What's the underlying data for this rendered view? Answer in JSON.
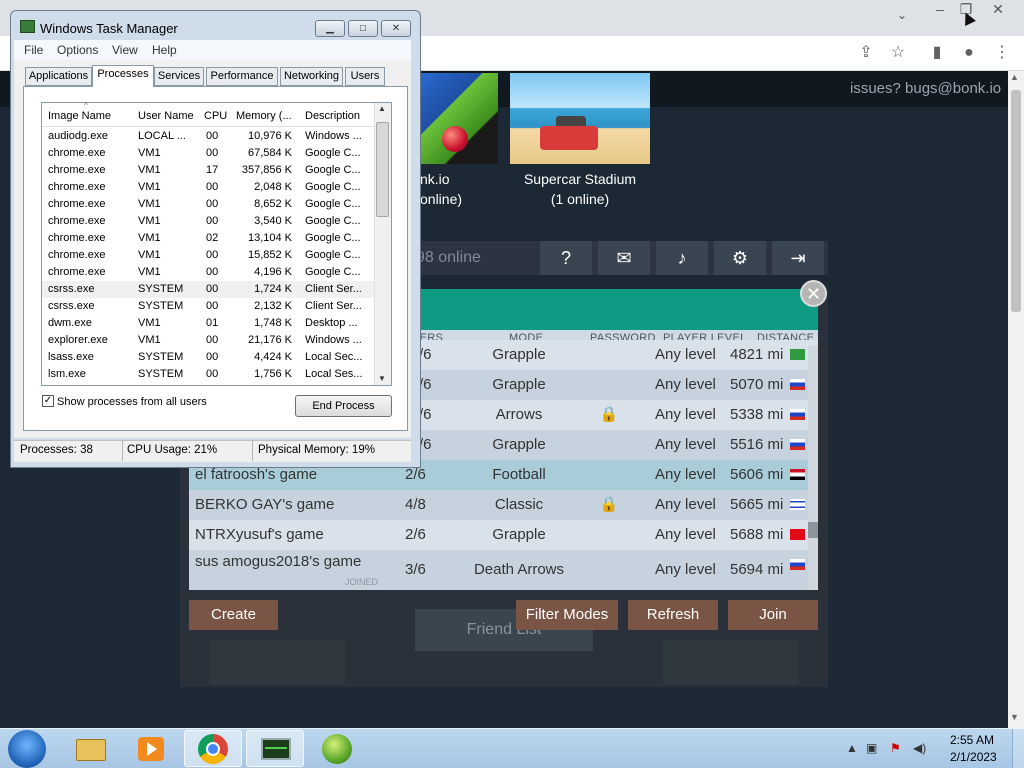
{
  "chrome": {
    "window_controls": [
      "–",
      "❐",
      "✕"
    ],
    "toolbar_icons": [
      "share-icon",
      "star-icon",
      "sidebar-icon",
      "profile-icon",
      "kebab-menu-icon"
    ]
  },
  "game": {
    "issues_text": "issues? bugs@bonk.io",
    "maps": [
      {
        "name": "nk.io",
        "online": "online)"
      },
      {
        "name": "Supercar Stadium",
        "online": "(1 online)"
      }
    ],
    "online_count": "98 online",
    "toolbar_icons": [
      "help-icon",
      "chat-icon",
      "speaker-icon",
      "settings-icon",
      "exit-icon"
    ],
    "close_label": "✕",
    "columns": [
      "YERS",
      "MODE",
      "PASSWORD",
      "PLAYER LEVEL",
      "DISTANCE"
    ],
    "rooms": [
      {
        "name": "",
        "players": "/6",
        "mode": "Grapple",
        "locked": false,
        "level": "Any level",
        "distance": "4821 mi",
        "flag": "Brazil"
      },
      {
        "name": "",
        "players": "/6",
        "mode": "Grapple",
        "locked": false,
        "level": "Any level",
        "distance": "5070 mi",
        "flag": "Russia"
      },
      {
        "name": "",
        "players": "/6",
        "mode": "Arrows",
        "locked": true,
        "level": "Any level",
        "distance": "5338 mi",
        "flag": "Russia"
      },
      {
        "name": "",
        "players": "/6",
        "mode": "Grapple",
        "locked": false,
        "level": "Any level",
        "distance": "5516 mi",
        "flag": "Russia"
      },
      {
        "name": "el fatroosh's game",
        "players": "2/6",
        "mode": "Football",
        "locked": false,
        "level": "Any level",
        "distance": "5606 mi",
        "flag": "Egypt"
      },
      {
        "name": "BERKO GAY's game",
        "players": "4/8",
        "mode": "Classic",
        "locked": true,
        "level": "Any level",
        "distance": "5665 mi",
        "flag": "Israel"
      },
      {
        "name": "NTRXyusuf's game",
        "players": "2/6",
        "mode": "Grapple",
        "locked": false,
        "level": "Any level",
        "distance": "5688 mi",
        "flag": "Turkey"
      },
      {
        "name": "sus amogus2018's game",
        "players": "3/6",
        "mode": "Death Arrows",
        "locked": false,
        "level": "Any level",
        "distance": "5694 mi",
        "flag": "Russia"
      }
    ],
    "joined_label": "JOINED",
    "buttons": {
      "create": "Create",
      "filter_modes": "Filter Modes",
      "refresh": "Refresh",
      "join": "Join"
    },
    "friend_list": "Friend List",
    "colors": {
      "header_teal": "#0f9a84",
      "row_light": "#d9e2ea",
      "row_alt": "#c6d3de",
      "row_highlight": "#a9cdd8",
      "button_brown": "#7a5444"
    }
  },
  "task_manager": {
    "title": "Windows Task Manager",
    "menu": [
      "File",
      "Options",
      "View",
      "Help"
    ],
    "tabs": [
      "Applications",
      "Processes",
      "Services",
      "Performance",
      "Networking",
      "Users"
    ],
    "active_tab": "Processes",
    "columns": [
      "Image Name",
      "User Name",
      "CPU",
      "Memory (...",
      "Description"
    ],
    "processes": [
      {
        "name": "audiodg.exe",
        "user": "LOCAL ...",
        "cpu": "00",
        "mem": "10,976 K",
        "desc": "Windows ..."
      },
      {
        "name": "chrome.exe",
        "user": "VM1",
        "cpu": "00",
        "mem": "67,584 K",
        "desc": "Google C..."
      },
      {
        "name": "chrome.exe",
        "user": "VM1",
        "cpu": "17",
        "mem": "357,856 K",
        "desc": "Google C..."
      },
      {
        "name": "chrome.exe",
        "user": "VM1",
        "cpu": "00",
        "mem": "2,048 K",
        "desc": "Google C..."
      },
      {
        "name": "chrome.exe",
        "user": "VM1",
        "cpu": "00",
        "mem": "8,652 K",
        "desc": "Google C..."
      },
      {
        "name": "chrome.exe",
        "user": "VM1",
        "cpu": "00",
        "mem": "3,540 K",
        "desc": "Google C..."
      },
      {
        "name": "chrome.exe",
        "user": "VM1",
        "cpu": "02",
        "mem": "13,104 K",
        "desc": "Google C..."
      },
      {
        "name": "chrome.exe",
        "user": "VM1",
        "cpu": "00",
        "mem": "15,852 K",
        "desc": "Google C..."
      },
      {
        "name": "chrome.exe",
        "user": "VM1",
        "cpu": "00",
        "mem": "4,196 K",
        "desc": "Google C..."
      },
      {
        "name": "csrss.exe",
        "user": "SYSTEM",
        "cpu": "00",
        "mem": "1,724 K",
        "desc": "Client Ser..."
      },
      {
        "name": "csrss.exe",
        "user": "SYSTEM",
        "cpu": "00",
        "mem": "2,132 K",
        "desc": "Client Ser..."
      },
      {
        "name": "dwm.exe",
        "user": "VM1",
        "cpu": "01",
        "mem": "1,748 K",
        "desc": "Desktop ..."
      },
      {
        "name": "explorer.exe",
        "user": "VM1",
        "cpu": "00",
        "mem": "21,176 K",
        "desc": "Windows ..."
      },
      {
        "name": "lsass.exe",
        "user": "SYSTEM",
        "cpu": "00",
        "mem": "4,424 K",
        "desc": "Local Sec..."
      },
      {
        "name": "lsm.exe",
        "user": "SYSTEM",
        "cpu": "00",
        "mem": "1,756 K",
        "desc": "Local Ses..."
      }
    ],
    "selected_row": 9,
    "show_all_label": "Show processes from all users",
    "show_all_checked": true,
    "end_process_label": "End Process",
    "status": {
      "processes": "Processes: 38",
      "cpu": "CPU Usage: 21%",
      "memory": "Physical Memory: 19%"
    }
  },
  "taskbar": {
    "items": [
      "start-icon",
      "explorer-icon",
      "media-player-icon",
      "chrome-icon",
      "task-manager-icon",
      "windows-update-icon"
    ],
    "clock_time": "2:55 AM",
    "clock_date": "2/1/2023"
  }
}
